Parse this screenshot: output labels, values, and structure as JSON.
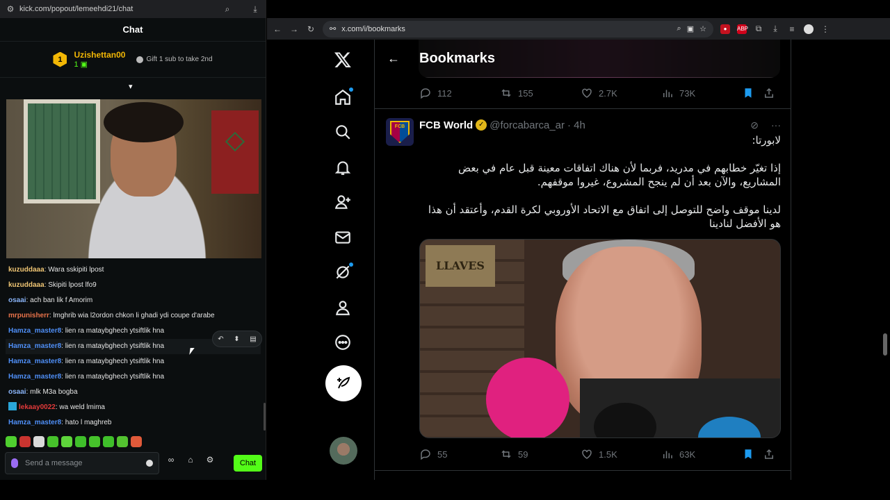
{
  "kick": {
    "url": "kick.com/popout/lemeehdi21/chat",
    "chat_title": "Chat",
    "gifter": {
      "rank": "1",
      "name": "Uzishettan00",
      "count": "1",
      "cta": "Gift 1 sub to take 2nd"
    },
    "messages": [
      {
        "user": "kuzuddaaa",
        "color": "#f0c674",
        "text": ": Wara sskipiti lpost"
      },
      {
        "user": "kuzuddaaa",
        "color": "#f0c674",
        "text": ": Skipiti lpost lfo9"
      },
      {
        "user": "osaai",
        "color": "#8ab4f8",
        "text": ": ach ban lik f Amorim"
      },
      {
        "user": "mrpunisherr",
        "color": "#e8734a",
        "text": ": lmghrib wia l2ordon chkon li ghadi ydi coupe d'arabe"
      },
      {
        "user": "Hamza_master8",
        "color": "#4f8ff7",
        "text": ": lien ra mataybghech ytsiftlik hna"
      },
      {
        "user": "Hamza_master8",
        "color": "#4f8ff7",
        "text": ": lien ra mataybghech ytsiftlik hna"
      },
      {
        "user": "Hamza_master8",
        "color": "#4f8ff7",
        "text": ": lien ra mataybghech ytsiftlik hna"
      },
      {
        "user": "Hamza_master8",
        "color": "#4f8ff7",
        "text": ": lien ra mataybghech ytsiftlik hna"
      },
      {
        "user": "osaai",
        "color": "#8ab4f8",
        "text": ": mlk M3a bogba"
      },
      {
        "user": "lekaay0022",
        "color": "#e23a3a",
        "text": ": wa weld lmima"
      },
      {
        "user": "Hamza_master8",
        "color": "#4f8ff7",
        "text": ": hato l maghreb"
      }
    ],
    "composer_placeholder": "Send a message",
    "send_label": "Chat"
  },
  "browser": {
    "url": "x.com/i/bookmarks"
  },
  "x": {
    "page_title": "Bookmarks",
    "prev_tweet_stats": {
      "replies": "112",
      "reposts": "155",
      "likes": "2.7K",
      "views": "73K"
    },
    "tweet": {
      "name": "FCB World",
      "handle": "@forcabarca_ar",
      "time": "· 4h",
      "avatar_text": "FCB",
      "paragraphs": [
        "لابورتا:",
        "إذا تغيّر خطابهم في مدريد، فربما لأن هناك اتفاقات معينة قبل عام في بعض المشاريع، والآن بعد أن لم ينجح المشروع، غيروا موقفهم.",
        "لدينا موقف واضح للتوصل إلى اتفاق مع الاتحاد الأوروبي لكرة القدم، وأعتقد أن هذا هو الأفضل لنادينا"
      ],
      "media_plaque": "LLAVES",
      "stats": {
        "replies": "55",
        "reposts": "59",
        "likes": "1.5K",
        "views": "63K"
      }
    }
  }
}
